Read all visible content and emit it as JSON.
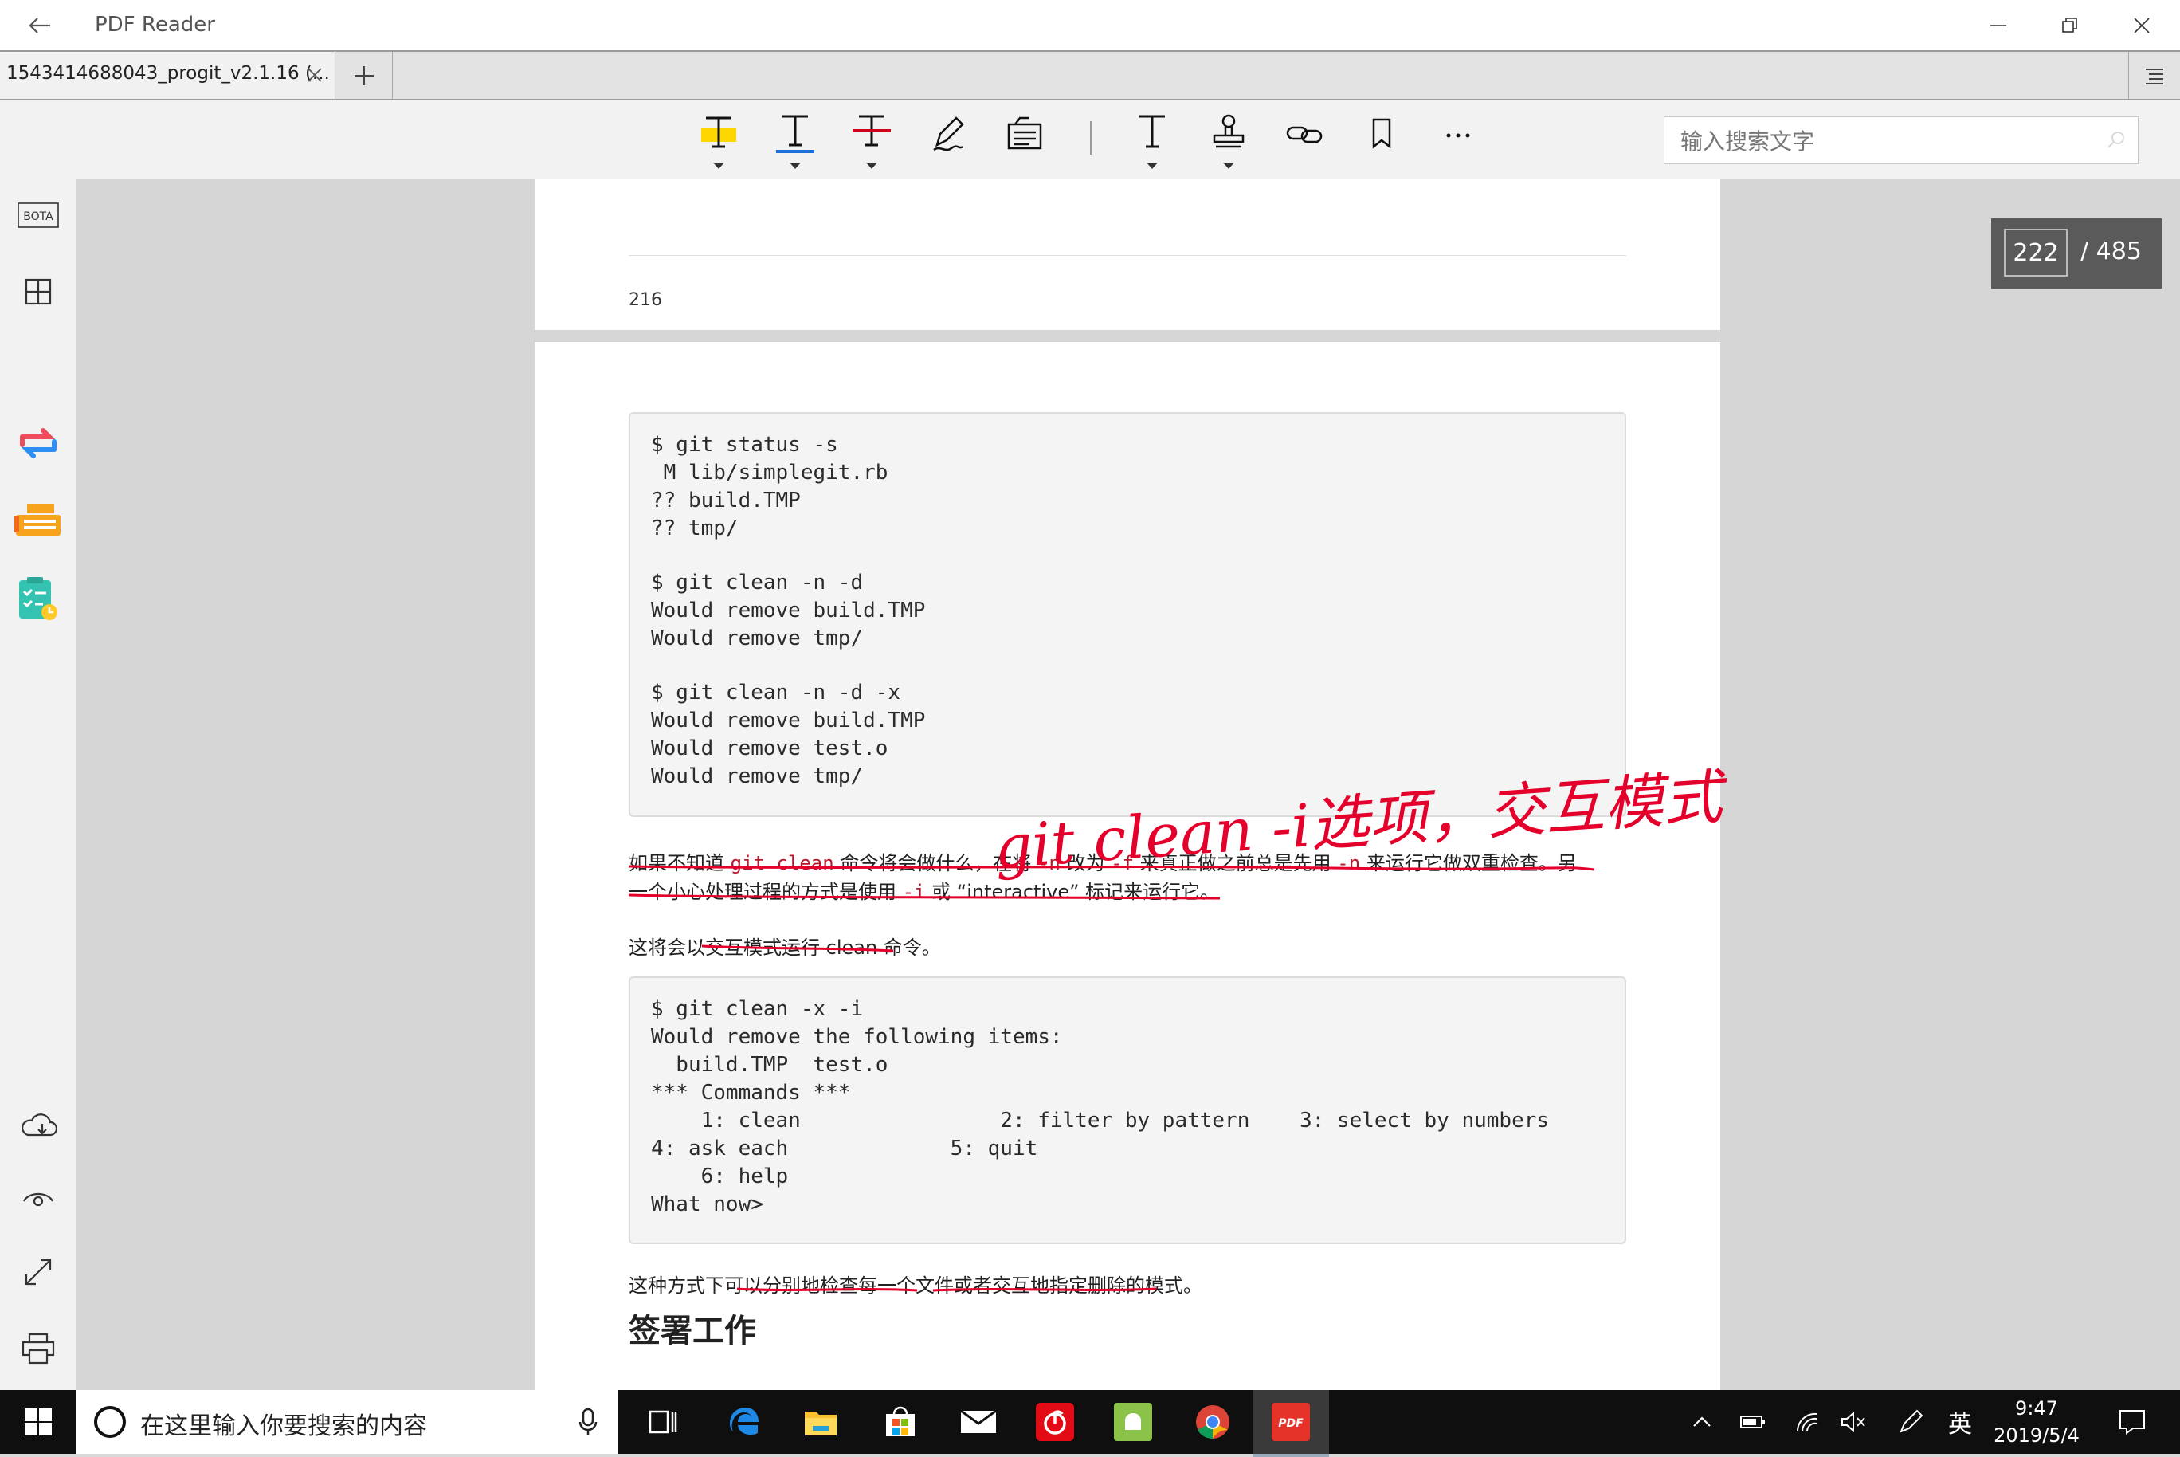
{
  "window": {
    "title": "PDF Reader"
  },
  "tabs": {
    "active_label": "1543414688043_progit_v2.1.16 (..."
  },
  "toolbar": {
    "tools": [
      "highlight-text",
      "underline-text",
      "strikeout-text",
      "freehand-pen",
      "text-note",
      "insert-text",
      "stamp",
      "link",
      "bookmark",
      "more"
    ],
    "search_placeholder": "输入搜索文字",
    "colors": {
      "highlight": "#ffd700",
      "underline": "#1e6fd9",
      "strikeout": "#d0021b"
    }
  },
  "sidebar": {
    "top": [
      "BOTA",
      "thumbnails-icon"
    ],
    "features": [
      "convert-icon",
      "fax-icon",
      "task-icon"
    ],
    "bottom": [
      "cloud-icon",
      "read-mode-icon",
      "fullscreen-icon",
      "print-icon"
    ],
    "bota_label": "BOTA"
  },
  "document": {
    "prev_page_number": "216",
    "code_block_1": [
      "$ git status -s",
      " M lib/simplegit.rb",
      "?? build.TMP",
      "?? tmp/",
      "",
      "$ git clean -n -d",
      "Would remove build.TMP",
      "Would remove tmp/",
      "",
      "$ git clean -n -d -x",
      "Would remove build.TMP",
      "Would remove test.o",
      "Would remove tmp/"
    ],
    "para1_line1": {
      "a": "如果不知道 ",
      "code1": "git clean",
      "b": " 命令将会做什么，在将 ",
      "code2": "-n",
      "c": " 改为 ",
      "code3": "-f",
      "d": " 来真正做之前总是先用 ",
      "code4": "-n",
      "e": " 来运行它做双重检查。另"
    },
    "para1_line2": {
      "a": "一个小心处理过程的方式是使用 ",
      "code1": "-i",
      "b": " 或 “interactive” 标记来运行它。"
    },
    "para2": "这将会以交互模式运行 clean 命令。",
    "code_block_2": [
      "$ git clean -x -i",
      "Would remove the following items:",
      "  build.TMP  test.o",
      "*** Commands ***",
      "    1: clean                2: filter by pattern    3: select by numbers",
      "4: ask each             5: quit",
      "    6: help",
      "What now>"
    ],
    "para3": "这种方式下可以分别地检查每一个文件或者交互地指定删除的模式。",
    "section_heading": "签署工作",
    "handwritten_note": "git clean -i选项，交互模式",
    "annotation_color": "#e4002b"
  },
  "page_counter": {
    "current": "222",
    "total": "/ 485"
  },
  "taskbar": {
    "search_text": "在这里输入你要搜索的内容",
    "apps": [
      "task-view",
      "edge",
      "file-explorer",
      "store",
      "mail",
      "netease-music",
      "android-app",
      "chrome",
      "pdf-reader"
    ],
    "ime_label": "英",
    "time": "9:47",
    "date": "2019/5/4"
  }
}
